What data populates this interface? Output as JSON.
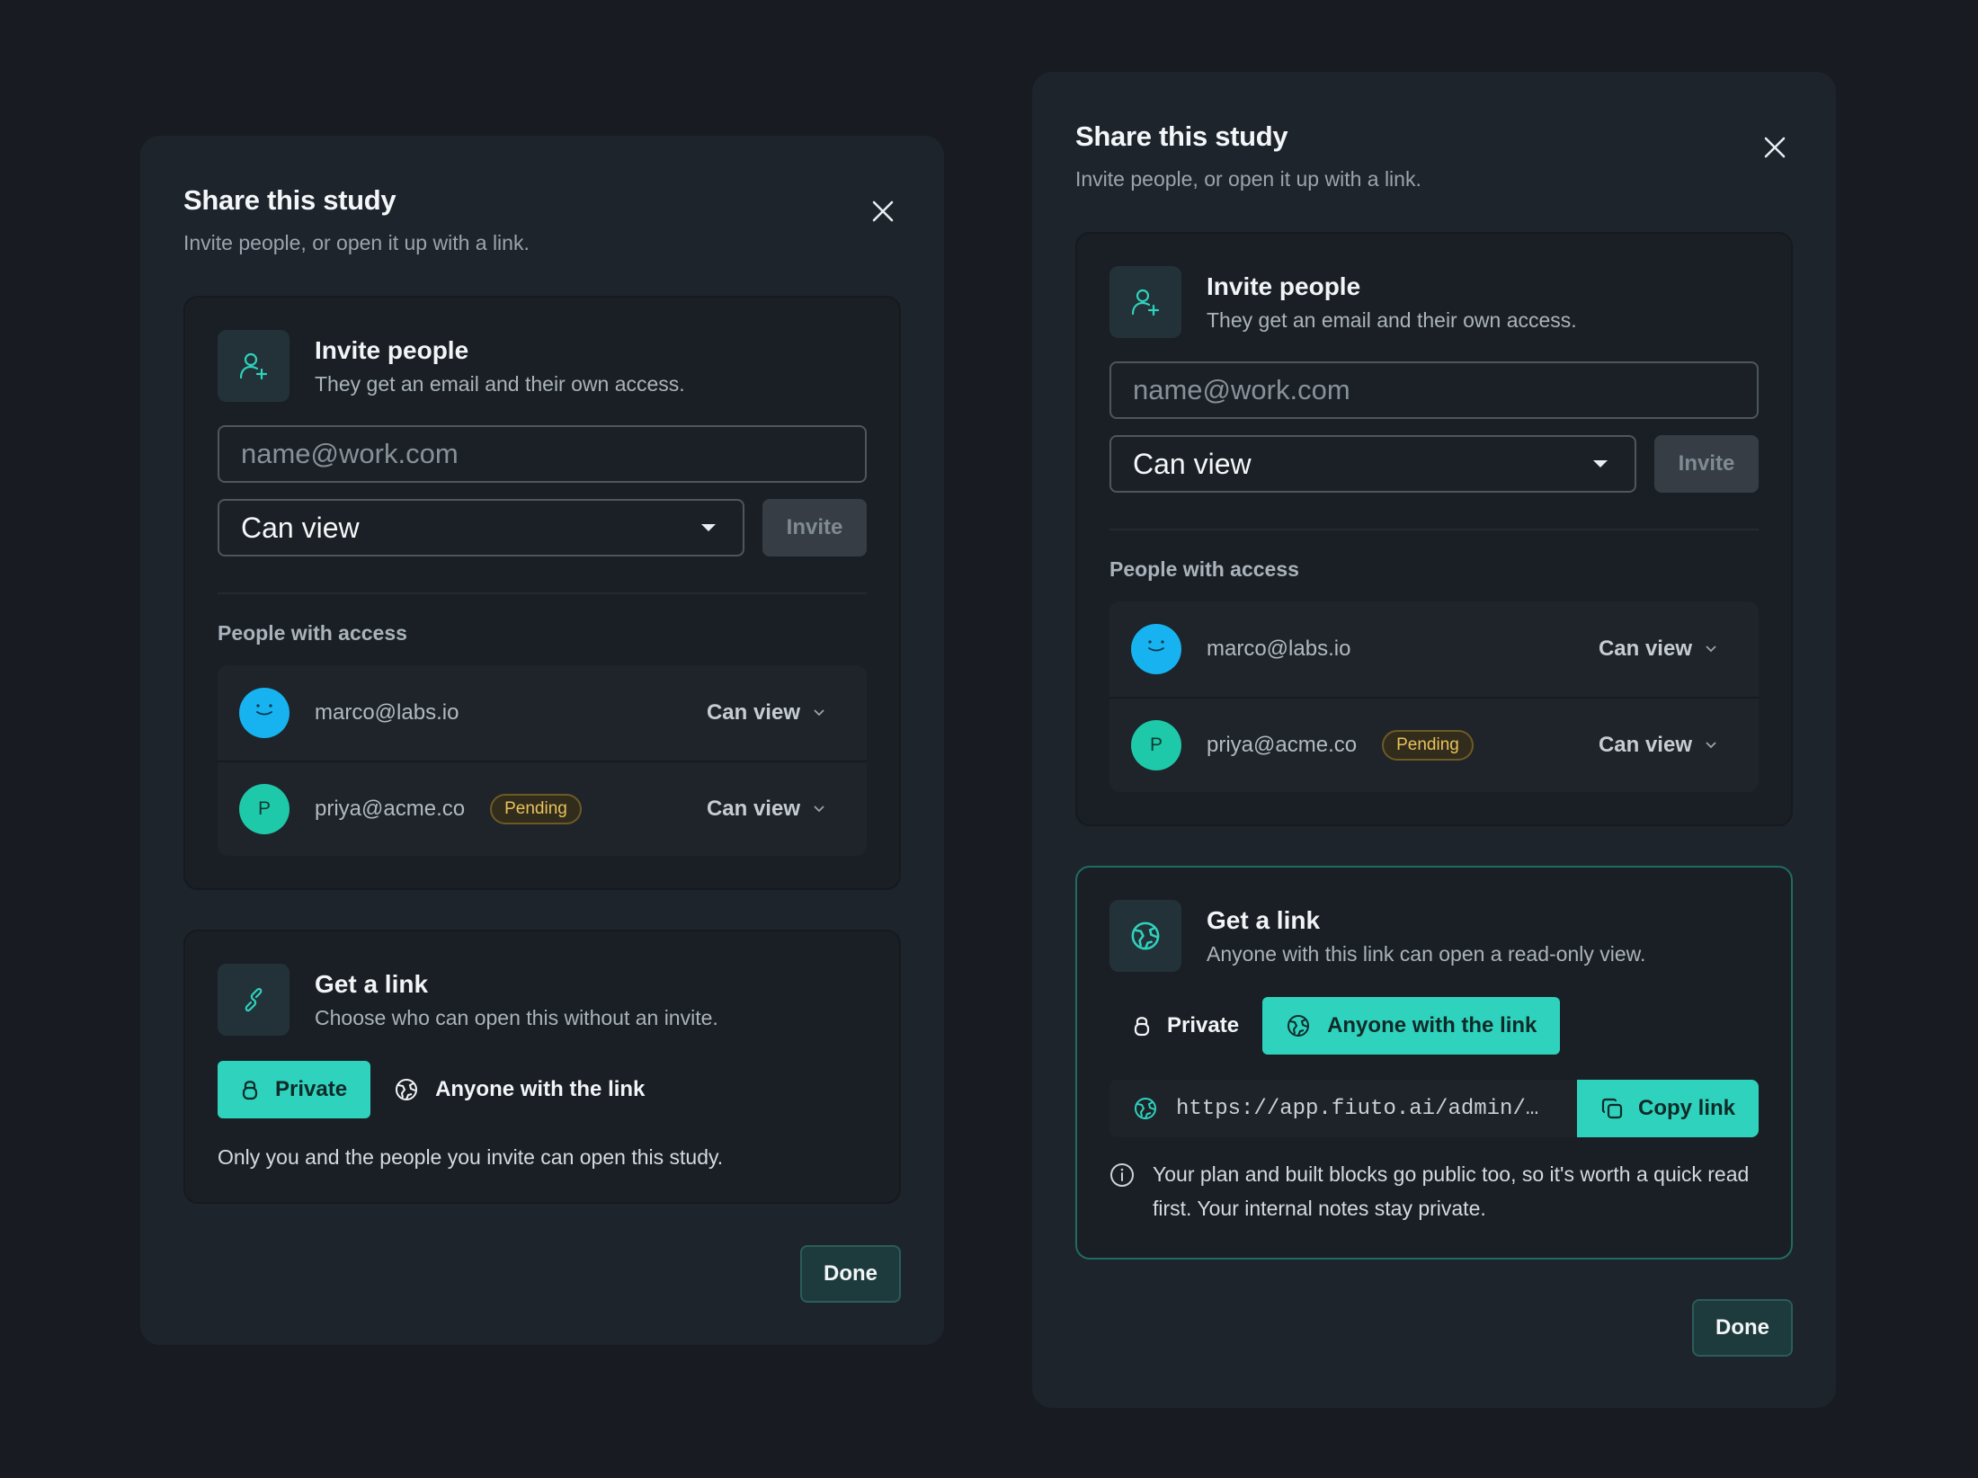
{
  "left": {
    "title": "Share this study",
    "subtitle": "Invite people, or open it up with a link.",
    "invite": {
      "title": "Invite people",
      "subtitle": "They get an email and their own access.",
      "email_placeholder": "name@work.com",
      "role": "Can view",
      "invite_label": "Invite"
    },
    "people_label": "People with access",
    "people": [
      {
        "email": "marco@labs.io",
        "role": "Can view",
        "avatar": "smile-face",
        "avatar_color": "#16b3f0"
      },
      {
        "email": "priya@acme.co",
        "badge": "Pending",
        "role": "Can view",
        "initial": "P",
        "avatar_color": "#1ec9a9"
      }
    ],
    "link": {
      "title": "Get a link",
      "subtitle": "Choose who can open this without an invite.",
      "private_label": "Private",
      "anyone_label": "Anyone with the link",
      "selected": "Private",
      "note": "Only you and the people you invite can open this study."
    },
    "done_label": "Done"
  },
  "right": {
    "title": "Share this study",
    "subtitle": "Invite people, or open it up with a link.",
    "invite": {
      "title": "Invite people",
      "subtitle": "They get an email and their own access.",
      "email_placeholder": "name@work.com",
      "role": "Can view",
      "invite_label": "Invite"
    },
    "people_label": "People with access",
    "people": [
      {
        "email": "marco@labs.io",
        "role": "Can view",
        "avatar": "smile-face",
        "avatar_color": "#16b3f0"
      },
      {
        "email": "priya@acme.co",
        "badge": "Pending",
        "role": "Can view",
        "initial": "P",
        "avatar_color": "#1ec9a9"
      }
    ],
    "link": {
      "title": "Get a link",
      "subtitle": "Anyone with this link can open a read-only view.",
      "private_label": "Private",
      "anyone_label": "Anyone with the link",
      "selected": "Anyone with the link",
      "url": "https://app.fiuto.ai/admin/…",
      "copy_label": "Copy link",
      "warning": "Your plan and built blocks go public too, so it's worth a quick read first. Your internal notes stay private."
    },
    "done_label": "Done"
  },
  "colors": {
    "background": "#181c22",
    "panel": "#1e242b",
    "accent": "#2fd2bd",
    "pending": "#e8c35a"
  }
}
